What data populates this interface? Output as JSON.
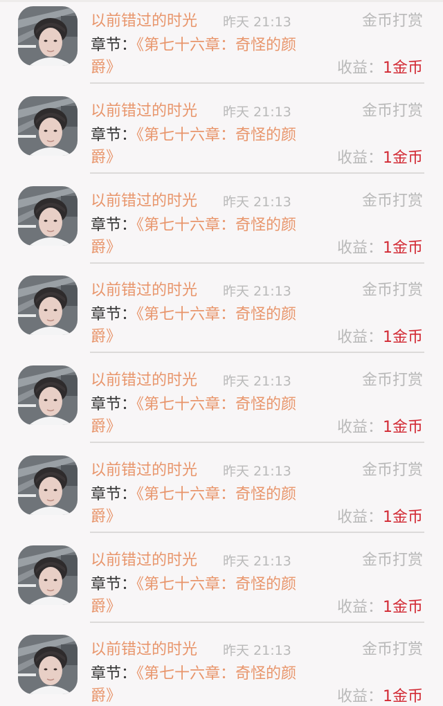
{
  "colors": {
    "background": "#f8f6f7",
    "accent": "#e8956b",
    "muted": "#b9b9b9",
    "text": "#333333",
    "earning": "#d22a34",
    "divider": "#dcdad9"
  },
  "records": [
    {
      "user": "以前错过的时光",
      "time": "昨天 21:13",
      "reward_type": "金币打赏",
      "chapter_prefix": "章节：",
      "chapter_title": "《第七十六章：奇怪的颜爵》",
      "earnings_label": "收益：",
      "earnings_value": "1金币",
      "avatar_icon": "user-avatar"
    },
    {
      "user": "以前错过的时光",
      "time": "昨天 21:13",
      "reward_type": "金币打赏",
      "chapter_prefix": "章节：",
      "chapter_title": "《第七十六章：奇怪的颜爵》",
      "earnings_label": "收益：",
      "earnings_value": "1金币",
      "avatar_icon": "user-avatar"
    },
    {
      "user": "以前错过的时光",
      "time": "昨天 21:13",
      "reward_type": "金币打赏",
      "chapter_prefix": "章节：",
      "chapter_title": "《第七十六章：奇怪的颜爵》",
      "earnings_label": "收益：",
      "earnings_value": "1金币",
      "avatar_icon": "user-avatar"
    },
    {
      "user": "以前错过的时光",
      "time": "昨天 21:13",
      "reward_type": "金币打赏",
      "chapter_prefix": "章节：",
      "chapter_title": "《第七十六章：奇怪的颜爵》",
      "earnings_label": "收益：",
      "earnings_value": "1金币",
      "avatar_icon": "user-avatar"
    },
    {
      "user": "以前错过的时光",
      "time": "昨天 21:13",
      "reward_type": "金币打赏",
      "chapter_prefix": "章节：",
      "chapter_title": "《第七十六章：奇怪的颜爵》",
      "earnings_label": "收益：",
      "earnings_value": "1金币",
      "avatar_icon": "user-avatar"
    },
    {
      "user": "以前错过的时光",
      "time": "昨天 21:13",
      "reward_type": "金币打赏",
      "chapter_prefix": "章节：",
      "chapter_title": "《第七十六章：奇怪的颜爵》",
      "earnings_label": "收益：",
      "earnings_value": "1金币",
      "avatar_icon": "user-avatar"
    },
    {
      "user": "以前错过的时光",
      "time": "昨天 21:13",
      "reward_type": "金币打赏",
      "chapter_prefix": "章节：",
      "chapter_title": "《第七十六章：奇怪的颜爵》",
      "earnings_label": "收益：",
      "earnings_value": "1金币",
      "avatar_icon": "user-avatar"
    },
    {
      "user": "以前错过的时光",
      "time": "昨天 21:13",
      "reward_type": "金币打赏",
      "chapter_prefix": "章节：",
      "chapter_title": "《第七十六章：奇怪的颜爵》",
      "earnings_label": "收益：",
      "earnings_value": "1金币",
      "avatar_icon": "user-avatar"
    }
  ]
}
